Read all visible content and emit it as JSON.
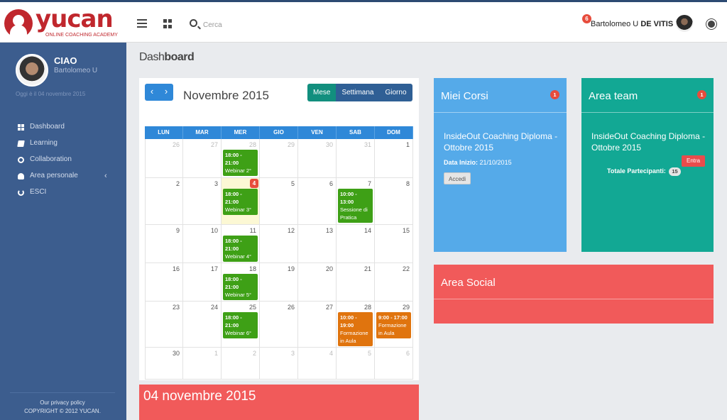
{
  "header": {
    "brand": "yucan",
    "brand_tagline": "ONLINE COACHING ACADEMY",
    "search_placeholder": "Cerca",
    "notifications": "6",
    "user_first": "Bartolomeo U",
    "user_last": "DE VITIS"
  },
  "sidebar": {
    "greeting": "CIAO",
    "user": "Bartolomeo U",
    "today_text": "Oggi è il 04 novembre 2015",
    "items": [
      {
        "label": "Dashboard",
        "icon": "dashboard-icon"
      },
      {
        "label": "Learning",
        "icon": "book-icon"
      },
      {
        "label": "Collaboration",
        "icon": "cogs-icon"
      },
      {
        "label": "Area personale",
        "icon": "user-icon"
      },
      {
        "label": "ESCI",
        "icon": "power-icon"
      }
    ],
    "footer_link": "Our privacy policy",
    "footer_copy": "COPYRIGHT © 2012 YUCAN."
  },
  "page": {
    "title_light": "Dash",
    "title_bold": "board"
  },
  "calendar": {
    "nav_prev": "‹",
    "nav_next": "›",
    "month": "Novembre 2015",
    "views": [
      "Mese",
      "Settimana",
      "Giorno"
    ],
    "weekdays": [
      "LUN",
      "MAR",
      "MER",
      "GIO",
      "VEN",
      "SAB",
      "DOM"
    ],
    "weeks": [
      [
        {
          "d": "26",
          "o": true
        },
        {
          "d": "27",
          "o": true
        },
        {
          "d": "28",
          "o": true,
          "ev": {
            "time": "18:00 - 21:00",
            "title": "Webinar 2°",
            "c": "green"
          }
        },
        {
          "d": "29",
          "o": true
        },
        {
          "d": "30",
          "o": true
        },
        {
          "d": "31",
          "o": true
        },
        {
          "d": "1"
        }
      ],
      [
        {
          "d": "2"
        },
        {
          "d": "3"
        },
        {
          "d": "4",
          "today": true,
          "ev": {
            "time": "18:00 - 21:00",
            "title": "Webinar 3°",
            "c": "green"
          }
        },
        {
          "d": "5"
        },
        {
          "d": "6"
        },
        {
          "d": "7",
          "ev": {
            "time": "10:00 - 13:00",
            "title": "Sessione di Pratica",
            "c": "green"
          }
        },
        {
          "d": "8"
        }
      ],
      [
        {
          "d": "9"
        },
        {
          "d": "10"
        },
        {
          "d": "11",
          "ev": {
            "time": "18:00 - 21:00",
            "title": "Webinar 4°",
            "c": "green"
          }
        },
        {
          "d": "12"
        },
        {
          "d": "13"
        },
        {
          "d": "14"
        },
        {
          "d": "15"
        }
      ],
      [
        {
          "d": "16"
        },
        {
          "d": "17"
        },
        {
          "d": "18",
          "ev": {
            "time": "18:00 - 21:00",
            "title": "Webinar 5°",
            "c": "green"
          }
        },
        {
          "d": "19"
        },
        {
          "d": "20"
        },
        {
          "d": "21"
        },
        {
          "d": "22"
        }
      ],
      [
        {
          "d": "23"
        },
        {
          "d": "24"
        },
        {
          "d": "25",
          "ev": {
            "time": "18:00 - 21:00",
            "title": "Webinar 6°",
            "c": "green"
          }
        },
        {
          "d": "26"
        },
        {
          "d": "27"
        },
        {
          "d": "28",
          "ev": {
            "time": "10:00 - 19:00",
            "title": "Formazione in Aula",
            "c": "orange"
          }
        },
        {
          "d": "29",
          "ev": {
            "time": "9:00 - 17:00",
            "title": "Formazione in Aula",
            "c": "orange"
          }
        }
      ],
      [
        {
          "d": "30"
        },
        {
          "d": "1",
          "o": true
        },
        {
          "d": "2",
          "o": true
        },
        {
          "d": "3",
          "o": true
        },
        {
          "d": "4",
          "o": true
        },
        {
          "d": "5",
          "o": true
        },
        {
          "d": "6",
          "o": true
        }
      ]
    ],
    "selected_date": "04 novembre 2015"
  },
  "miei_corsi": {
    "title": "Miei Corsi",
    "badge": "1",
    "course": "InsideOut Coaching Diploma - Ottobre 2015",
    "start_label": "Data Inizio:",
    "start_value": "21/10/2015",
    "button": "Accedi"
  },
  "area_team": {
    "title": "Area team",
    "badge": "1",
    "course": "InsideOut Coaching Diploma - Ottobre 2015",
    "button": "Entra",
    "participants_label": "Totale Partecipanti:",
    "participants": "15"
  },
  "area_social": {
    "title": "Area Social"
  },
  "colors": {
    "sidebar": "#3c5d8e",
    "calendar_head": "#2f88d8",
    "event_green": "#3ea016",
    "event_orange": "#e0740e",
    "social": "#f15a5a",
    "team": "#12a894",
    "courses": "#55aae9"
  }
}
